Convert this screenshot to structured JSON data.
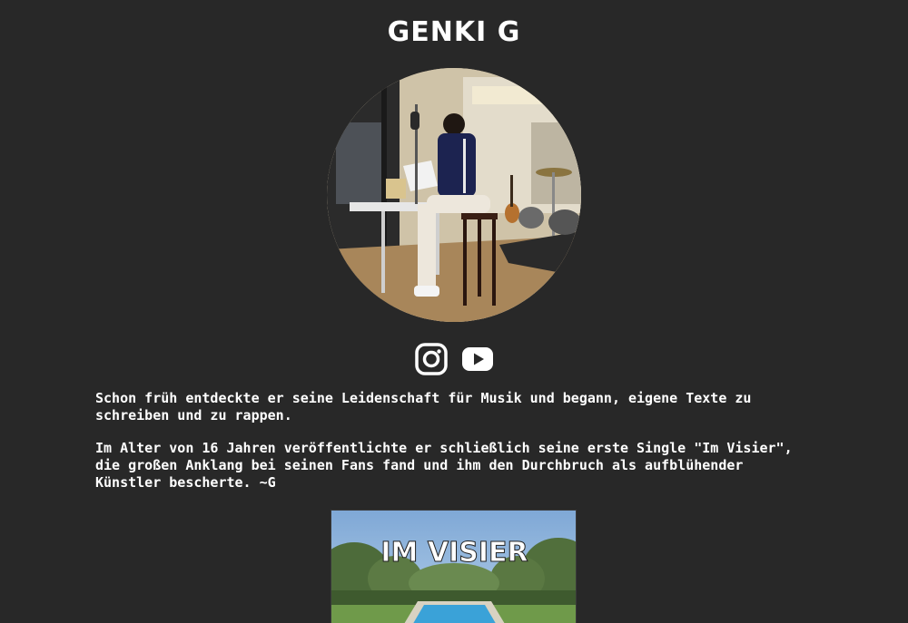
{
  "header": {
    "title": "GENKI G"
  },
  "profile": {
    "photo_alt": "Genki G im Studio"
  },
  "social": [
    {
      "name": "Instagram",
      "icon": "instagram-icon"
    },
    {
      "name": "YouTube",
      "icon": "youtube-icon"
    }
  ],
  "bio": {
    "paragraph_1": "Schon früh entdeckte er seine Leidenschaft für Musik und begann, eigene Texte zu schreiben und zu rappen.",
    "paragraph_2": "Im Alter von 16 Jahren veröffentlichte er schließlich seine erste Single \"Im Visier\", die großen Anklang bei seinen Fans fand und ihm den Durchbruch als aufblühender Künstler bescherte. ~G"
  },
  "single": {
    "cover_text": "IM VISIER"
  },
  "colors": {
    "background": "#282828",
    "text": "#ffffff"
  }
}
